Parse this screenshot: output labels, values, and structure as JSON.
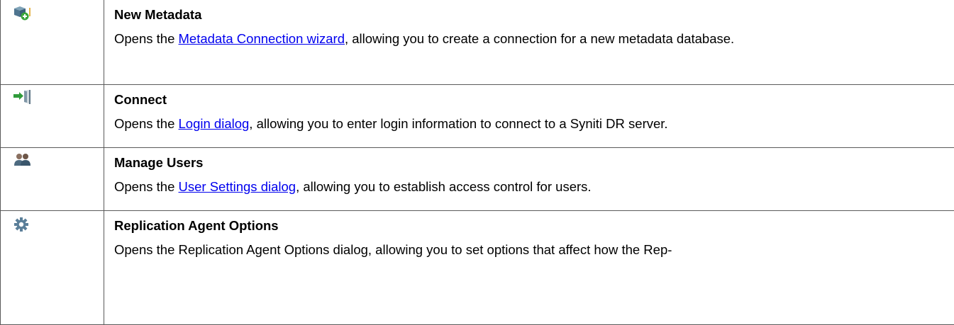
{
  "rows": [
    {
      "icon": "new-metadata-icon",
      "title": "New Metadata",
      "desc_before": "Opens the ",
      "link": "Metadata Connection wizard",
      "desc_after": ", allowing you to create a connection for a new metadata database."
    },
    {
      "icon": "connect-icon",
      "title": "Connect",
      "desc_before": "Opens the ",
      "link": "Login dialog",
      "desc_after": ", allowing you to enter login information to connect to a Syniti DR server."
    },
    {
      "icon": "users-icon",
      "title": "Manage Users",
      "desc_before": "Opens the ",
      "link": "User Settings dialog",
      "desc_after": ", allowing you to establish access control for users."
    },
    {
      "icon": "gear-icon",
      "title": "Replication Agent Options",
      "desc_before": "Opens the Replication Agent Options dialog, allowing you to set options that affect how the Rep-",
      "link": "",
      "desc_after": ""
    }
  ],
  "colors": {
    "border": "#5a5a5a",
    "link": "#0000ee"
  }
}
